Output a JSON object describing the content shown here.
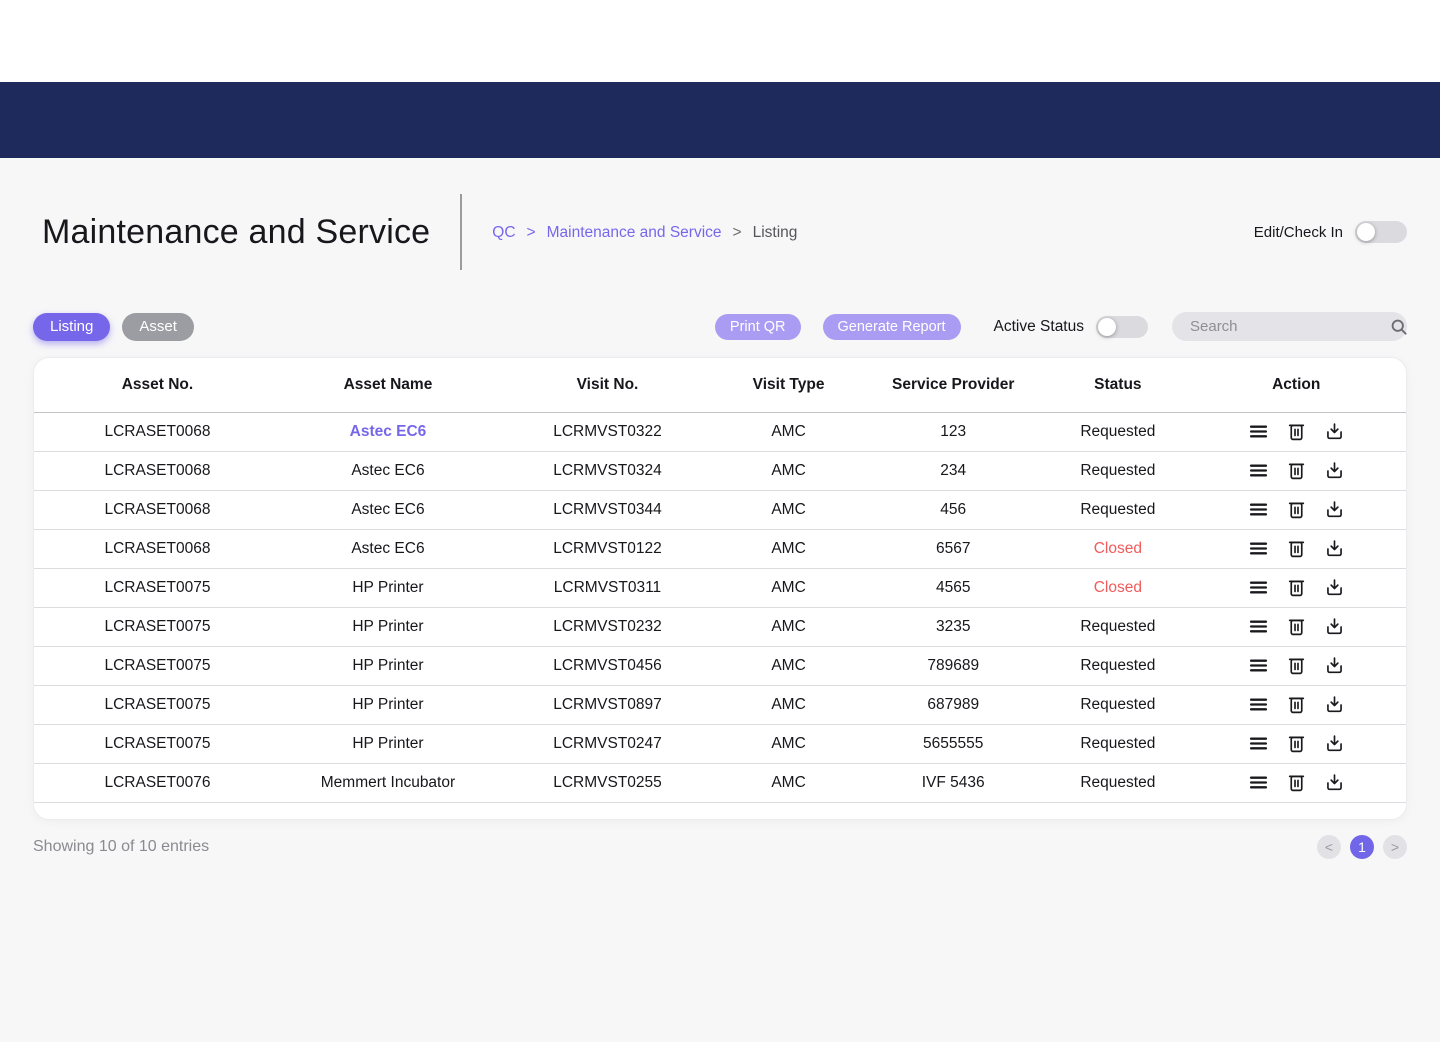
{
  "header": {
    "title": "Maintenance and Service",
    "breadcrumb": {
      "root": "QC",
      "separator": ">",
      "section": "Maintenance and Service",
      "current": "Listing"
    },
    "edit_checkin_label": "Edit/Check In"
  },
  "tabs": [
    {
      "label": "Listing",
      "active": true
    },
    {
      "label": "Asset",
      "active": false
    }
  ],
  "toolbar": {
    "print_qr": "Print QR",
    "generate_report": "Generate Report",
    "active_status_label": "Active Status",
    "search_placeholder": "Search"
  },
  "table": {
    "columns": [
      "Asset No.",
      "Asset Name",
      "Visit No.",
      "Visit Type",
      "Service Provider",
      "Status",
      "Action"
    ],
    "actions": [
      "menu",
      "delete",
      "download"
    ],
    "rows": [
      {
        "asset_no": "LCRASET0068",
        "asset_name": "Astec EC6",
        "visit_no": "LCRMVST0322",
        "visit_type": "AMC",
        "service_provider": "123",
        "status": "Requested",
        "link": true
      },
      {
        "asset_no": "LCRASET0068",
        "asset_name": "Astec EC6",
        "visit_no": "LCRMVST0324",
        "visit_type": "AMC",
        "service_provider": "234",
        "status": "Requested"
      },
      {
        "asset_no": "LCRASET0068",
        "asset_name": "Astec EC6",
        "visit_no": "LCRMVST0344",
        "visit_type": "AMC",
        "service_provider": "456",
        "status": "Requested"
      },
      {
        "asset_no": "LCRASET0068",
        "asset_name": "Astec EC6",
        "visit_no": "LCRMVST0122",
        "visit_type": "AMC",
        "service_provider": "6567",
        "status": "Closed"
      },
      {
        "asset_no": "LCRASET0075",
        "asset_name": "HP Printer",
        "visit_no": "LCRMVST0311",
        "visit_type": "AMC",
        "service_provider": "4565",
        "status": "Closed"
      },
      {
        "asset_no": "LCRASET0075",
        "asset_name": "HP Printer",
        "visit_no": "LCRMVST0232",
        "visit_type": "AMC",
        "service_provider": "3235",
        "status": "Requested"
      },
      {
        "asset_no": "LCRASET0075",
        "asset_name": "HP Printer",
        "visit_no": "LCRMVST0456",
        "visit_type": "AMC",
        "service_provider": "789689",
        "status": "Requested"
      },
      {
        "asset_no": "LCRASET0075",
        "asset_name": "HP Printer",
        "visit_no": "LCRMVST0897",
        "visit_type": "AMC",
        "service_provider": "687989",
        "status": "Requested"
      },
      {
        "asset_no": "LCRASET0075",
        "asset_name": "HP Printer",
        "visit_no": "LCRMVST0247",
        "visit_type": "AMC",
        "service_provider": "5655555",
        "status": "Requested"
      },
      {
        "asset_no": "LCRASET0076",
        "asset_name": "Memmert Incubator",
        "visit_no": "LCRMVST0255",
        "visit_type": "AMC",
        "service_provider": "IVF 5436",
        "status": "Requested"
      }
    ]
  },
  "footer": {
    "summary": "Showing 10 of 10 entries",
    "pagination": {
      "prev": "<",
      "page": "1",
      "next": ">"
    }
  },
  "colors": {
    "navy": "#1E2A5C",
    "accent_purple": "#7667EA",
    "light_purple": "#A99CF2",
    "grey_pill": "#9C9CA3",
    "closed_red": "#F05B5B"
  }
}
